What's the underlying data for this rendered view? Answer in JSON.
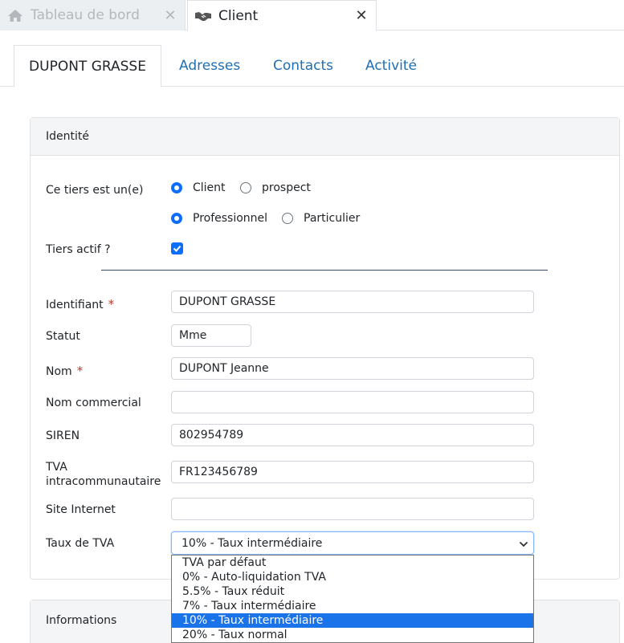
{
  "window_tabs": [
    {
      "label": "Tableau de bord",
      "icon": "home-icon",
      "active": false
    },
    {
      "label": "Client",
      "icon": "handshake-icon",
      "active": true
    }
  ],
  "page_tabs": [
    "DUPONT GRASSE",
    "Adresses",
    "Contacts",
    "Activité"
  ],
  "identity": {
    "header": "Identité",
    "tiers_type_label": "Ce tiers est un(e)",
    "type_options": [
      "Client",
      "prospect"
    ],
    "type_selected": "Client",
    "nature_options": [
      "Professionnel",
      "Particulier"
    ],
    "nature_selected": "Professionnel",
    "active_label": "Tiers actif ?",
    "active_checked": true,
    "fields": {
      "identifiant": {
        "label": "Identifiant",
        "value": "DUPONT GRASSE",
        "required": "*"
      },
      "statut": {
        "label": "Statut",
        "value": "Mme"
      },
      "nom": {
        "label": "Nom",
        "value": "DUPONT Jeanne",
        "required": "*"
      },
      "nom_commercial": {
        "label": "Nom commercial",
        "value": ""
      },
      "siren": {
        "label": "SIREN",
        "value": "802954789"
      },
      "tva_intra": {
        "label_line1": "TVA",
        "label_line2": "intracommunautaire",
        "value": "FR123456789"
      },
      "site": {
        "label": "Site Internet",
        "value": ""
      }
    },
    "vat_rate": {
      "label": "Taux de TVA",
      "selected": "10% - Taux intermédiaire",
      "options": [
        "TVA par défaut",
        "0% - Auto-liquidation TVA",
        "5.5% - Taux réduit",
        "7% - Taux intermédiaire",
        "10% - Taux intermédiaire",
        "20% - Taux normal"
      ],
      "highlighted_index": 4
    }
  },
  "informations": {
    "header": "Informations"
  },
  "colors": {
    "accent": "#0d6efd",
    "link": "#1f6fb2",
    "highlight": "#1a73e8",
    "required": "#c0392b"
  }
}
